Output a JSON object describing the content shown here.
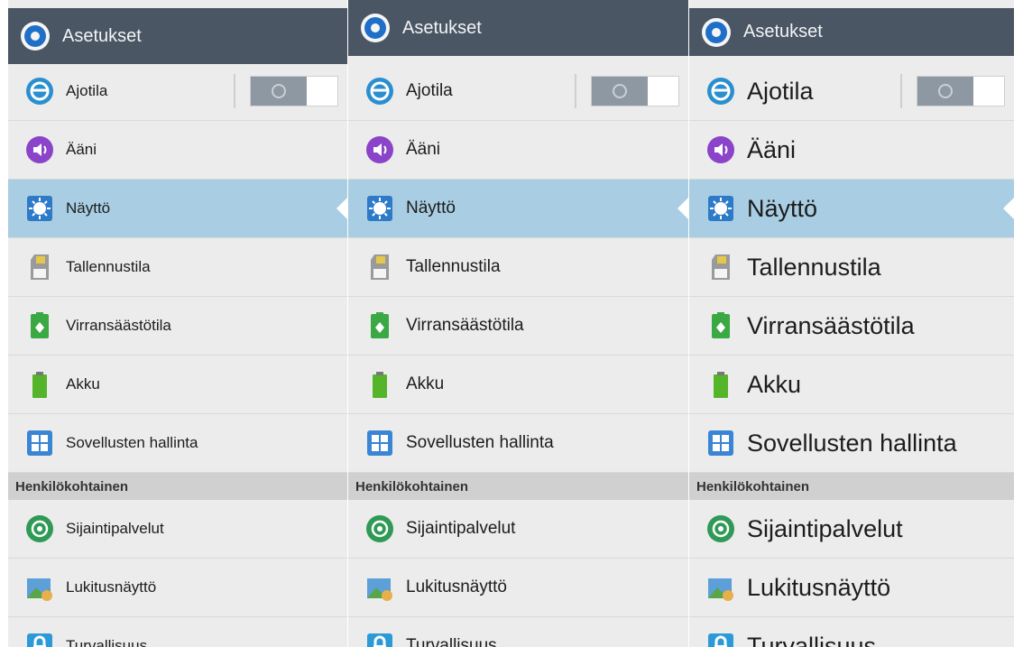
{
  "actionbar": {
    "title": "Asetukset"
  },
  "items": [
    {
      "label": "Ajotila",
      "icon": "steering-wheel-icon"
    },
    {
      "label": "Ääni",
      "icon": "speaker-icon"
    },
    {
      "label": "Näyttö",
      "icon": "brightness-icon"
    },
    {
      "label": "Tallennustila",
      "icon": "sd-card-icon"
    },
    {
      "label": "Virransäästötila",
      "icon": "power-saving-icon"
    },
    {
      "label": "Akku",
      "icon": "battery-icon"
    },
    {
      "label": "Sovellusten hallinta",
      "icon": "app-grid-icon"
    }
  ],
  "section": {
    "title": "Henkilökohtainen"
  },
  "personal_items": [
    {
      "label": "Sijaintipalvelut",
      "icon": "location-icon"
    },
    {
      "label": "Lukitusnäyttö",
      "icon": "lock-screen-icon"
    },
    {
      "label": "Turvallisuus",
      "icon": "padlock-icon"
    }
  ],
  "toggle": {
    "state": "off"
  },
  "selected_item": "Näyttö",
  "colors": {
    "actionbar": "#4a5663",
    "selected_row": "#a9cde2",
    "section_header": "#d0d0d0",
    "background": "#ececec"
  }
}
